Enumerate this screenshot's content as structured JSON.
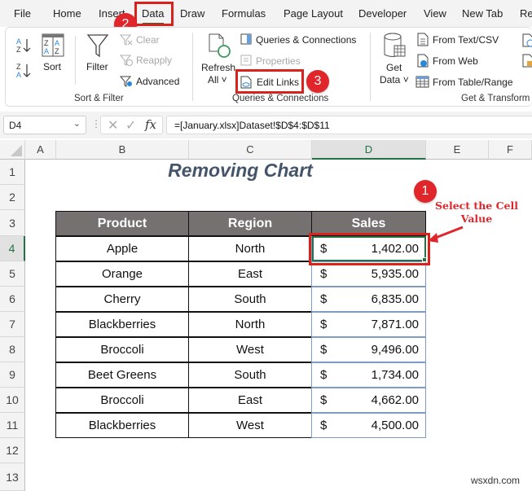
{
  "menu_tabs": [
    {
      "label": "File",
      "active": false
    },
    {
      "label": "Home",
      "active": false
    },
    {
      "label": "Insert",
      "active": false
    },
    {
      "label": "Data",
      "active": true
    },
    {
      "label": "Draw",
      "active": false
    },
    {
      "label": "Formulas",
      "active": false
    },
    {
      "label": "Page Layout",
      "active": false
    },
    {
      "label": "Developer",
      "active": false
    },
    {
      "label": "View",
      "active": false
    },
    {
      "label": "New Tab",
      "active": false
    },
    {
      "label": "Re",
      "active": false
    }
  ],
  "ribbon": {
    "sort_filter": {
      "sort_label": "Sort",
      "filter_label": "Filter",
      "clear_label": "Clear",
      "reapply_label": "Reapply",
      "advanced_label": "Advanced",
      "group_label": "Sort & Filter"
    },
    "queries": {
      "refresh_label": "Refresh",
      "refresh_all_label": "All",
      "queries_connections_label": "Queries & Connections",
      "properties_label": "Properties",
      "edit_links_label": "Edit Links",
      "group_label": "Queries & Connections"
    },
    "get_transform": {
      "get_label": "Get",
      "data_label": "Data",
      "from_text_label": "From Text/CSV",
      "from_web_label": "From Web",
      "from_table_label": "From Table/Range",
      "group_label": "Get & Transform"
    }
  },
  "formula_bar": {
    "name_box": "D4",
    "formula": "=[January.xlsx]Dataset!$D$4:$D$11",
    "fx_label": "fx"
  },
  "columns": [
    "A",
    "B",
    "C",
    "D",
    "E",
    "F"
  ],
  "selected_column": "D",
  "rows": [
    "1",
    "2",
    "3",
    "4",
    "5",
    "6",
    "7",
    "8",
    "9",
    "10",
    "11",
    "12",
    "13"
  ],
  "selected_row": "4",
  "sheet_title": "Removing Chart",
  "table": {
    "headers": [
      "Product",
      "Region",
      "Sales"
    ],
    "currency_symbol": "$",
    "rows": [
      {
        "product": "Apple",
        "region": "North",
        "sales": "1,402.00"
      },
      {
        "product": "Orange",
        "region": "East",
        "sales": "5,935.00"
      },
      {
        "product": "Cherry",
        "region": "South",
        "sales": "6,835.00"
      },
      {
        "product": "Blackberries",
        "region": "North",
        "sales": "7,871.00"
      },
      {
        "product": "Broccoli",
        "region": "West",
        "sales": "9,496.00"
      },
      {
        "product": "Beet Greens",
        "region": "South",
        "sales": "1,734.00"
      },
      {
        "product": "Broccoli",
        "region": "East",
        "sales": "4,662.00"
      },
      {
        "product": "Blackberries",
        "region": "West",
        "sales": "4,500.00"
      }
    ]
  },
  "annotations": {
    "step1": "1",
    "step2": "2",
    "step3": "3",
    "callout_line1": "Select the Cell",
    "callout_line2": "Value",
    "accent_color": "#e0262b"
  },
  "watermark": "wsxdn.com"
}
